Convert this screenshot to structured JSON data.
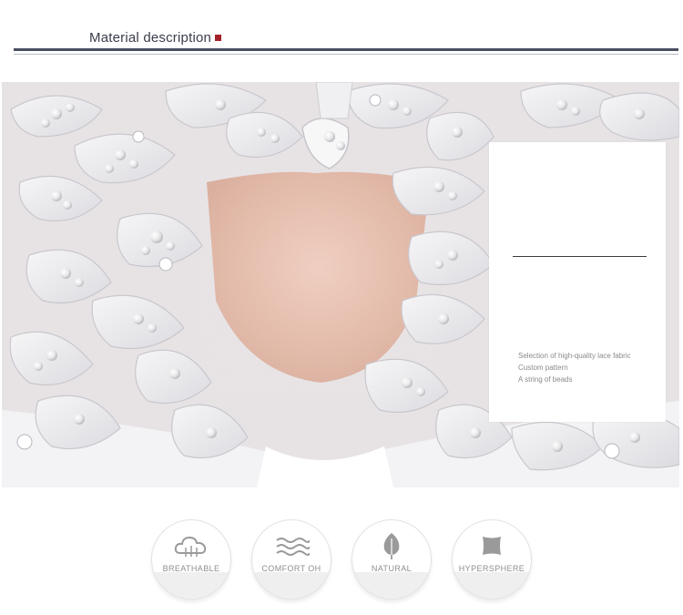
{
  "header": {
    "title": "Material description"
  },
  "info_card": {
    "items": [
      "Selection of high-quality lace fabric",
      "Custom pattern",
      "A string of beads"
    ]
  },
  "features": [
    {
      "label": "BREATHABLE",
      "icon": "cloud-icon"
    },
    {
      "label": "COMFORT OH",
      "icon": "waves-icon"
    },
    {
      "label": "NATURAL",
      "icon": "leaf-icon"
    },
    {
      "label": "HYPERSPHERE",
      "icon": "pillow-icon"
    }
  ],
  "colors": {
    "accent_marker": "#a3222a",
    "rule": "#4a4f63",
    "skin": "#e8c1b2",
    "lace": "#f4f3f4"
  }
}
